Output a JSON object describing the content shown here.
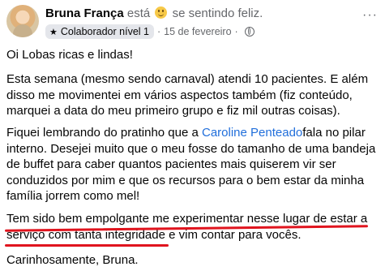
{
  "post": {
    "author": "Bruna França",
    "verb": "está",
    "feeling": "se sentindo feliz.",
    "feeling_icon": "smiling-face-icon",
    "badge_label": "Colaborador nível 1",
    "badge_icon": "star-icon",
    "separator": "·",
    "date": "15 de fevereiro",
    "separator2": "·",
    "audience_icon": "globe-icon",
    "more_label": "···"
  },
  "body": {
    "p1": "Oi Lobas ricas e lindas!",
    "p2": "Esta semana (mesmo sendo carnaval) atendi 10 pacientes. E além disso me movimentei em vários aspectos também (fiz conteúdo, marquei a data do meu primeiro grupo e fiz mil outras coisas).",
    "p3_before": "Fiquei lembrando do pratinho que a ",
    "p3_mention": "Caroline Penteado",
    "p3_after": "fala no pilar interno. Desejei muito que o meu fosse do tamanho de uma bandeja de buffet para caber quantos pacientes mais quiserem vir ser conduzidos por mim e que os recursos para o bem estar da minha família jorrem como mel!",
    "p4": "Tem sido bem empolgante me experimentar nesse lugar de estar a serviço com tanta integridade e vim contar para vocês.",
    "p5": "Carinhosamente, Bruna."
  },
  "colors": {
    "link": "#216fdb",
    "underline_annotation": "#e0141e",
    "muted": "#65676b"
  }
}
